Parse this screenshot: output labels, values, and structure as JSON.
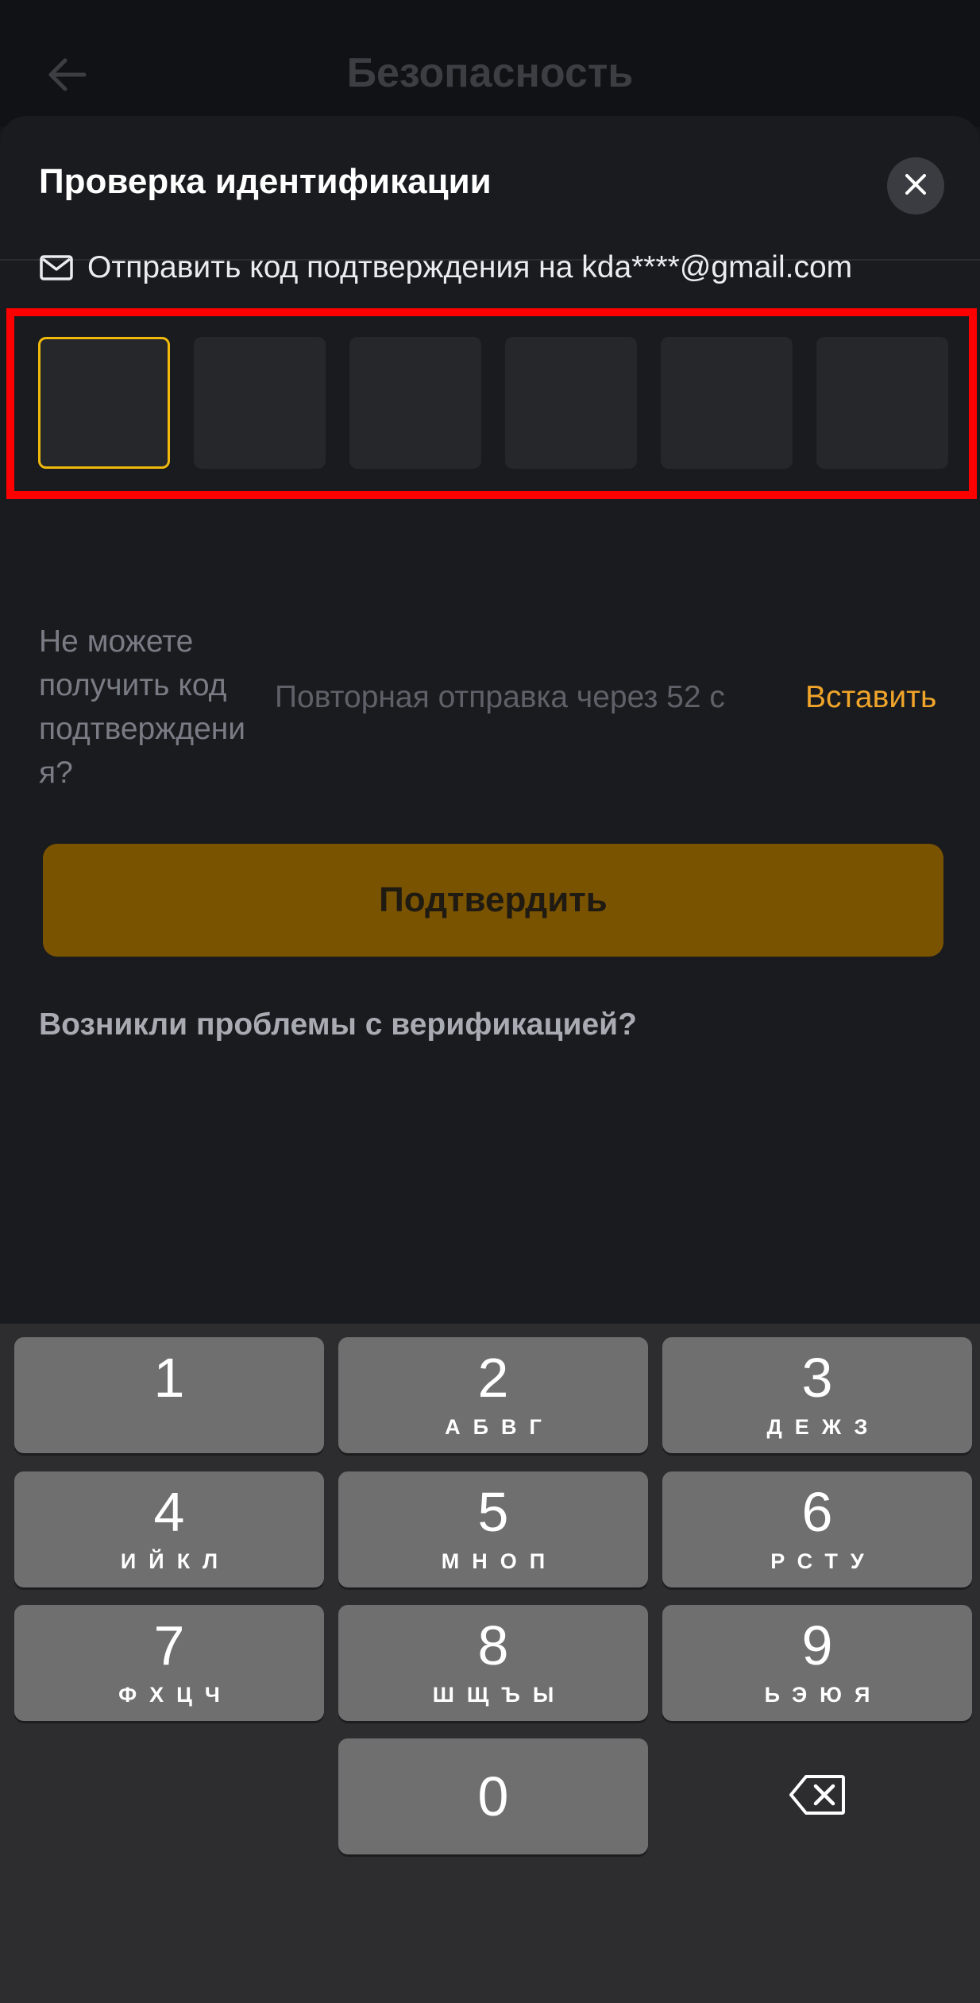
{
  "underlying_page": {
    "title": "Безопасность"
  },
  "sheet": {
    "title": "Проверка идентификации",
    "send_code_text": "Отправить код подтверждения на kda****@gmail.com",
    "cant_receive_text": "Не можете получить код подтверждени я?",
    "resend_text": "Повторная отправка через 52 с",
    "paste_label": "Вставить",
    "confirm_label": "Подтвердить",
    "problems_text": "Возникли проблемы с верификацией?",
    "code_length": 6,
    "active_box": 1
  },
  "keyboard": {
    "keys": [
      {
        "digit": "1",
        "letters": ""
      },
      {
        "digit": "2",
        "letters": "АБВГ"
      },
      {
        "digit": "3",
        "letters": "ДЕЖЗ"
      },
      {
        "digit": "4",
        "letters": "ИЙКЛ"
      },
      {
        "digit": "5",
        "letters": "МНОП"
      },
      {
        "digit": "6",
        "letters": "РСТУ"
      },
      {
        "digit": "7",
        "letters": "ФХЦЧ"
      },
      {
        "digit": "8",
        "letters": "ШЩЪЫ"
      },
      {
        "digit": "9",
        "letters": "ЬЭЮЯ"
      },
      {
        "digit": "0",
        "letters": ""
      }
    ]
  },
  "colors": {
    "accent": "#f0b90b",
    "link": "#f0a52a",
    "confirm_bg": "#7a5300",
    "highlight_frame": "#ff0000"
  },
  "icons": {
    "back": "arrow-left-icon",
    "close": "close-icon",
    "mail": "mail-icon",
    "delete": "backspace-icon"
  }
}
